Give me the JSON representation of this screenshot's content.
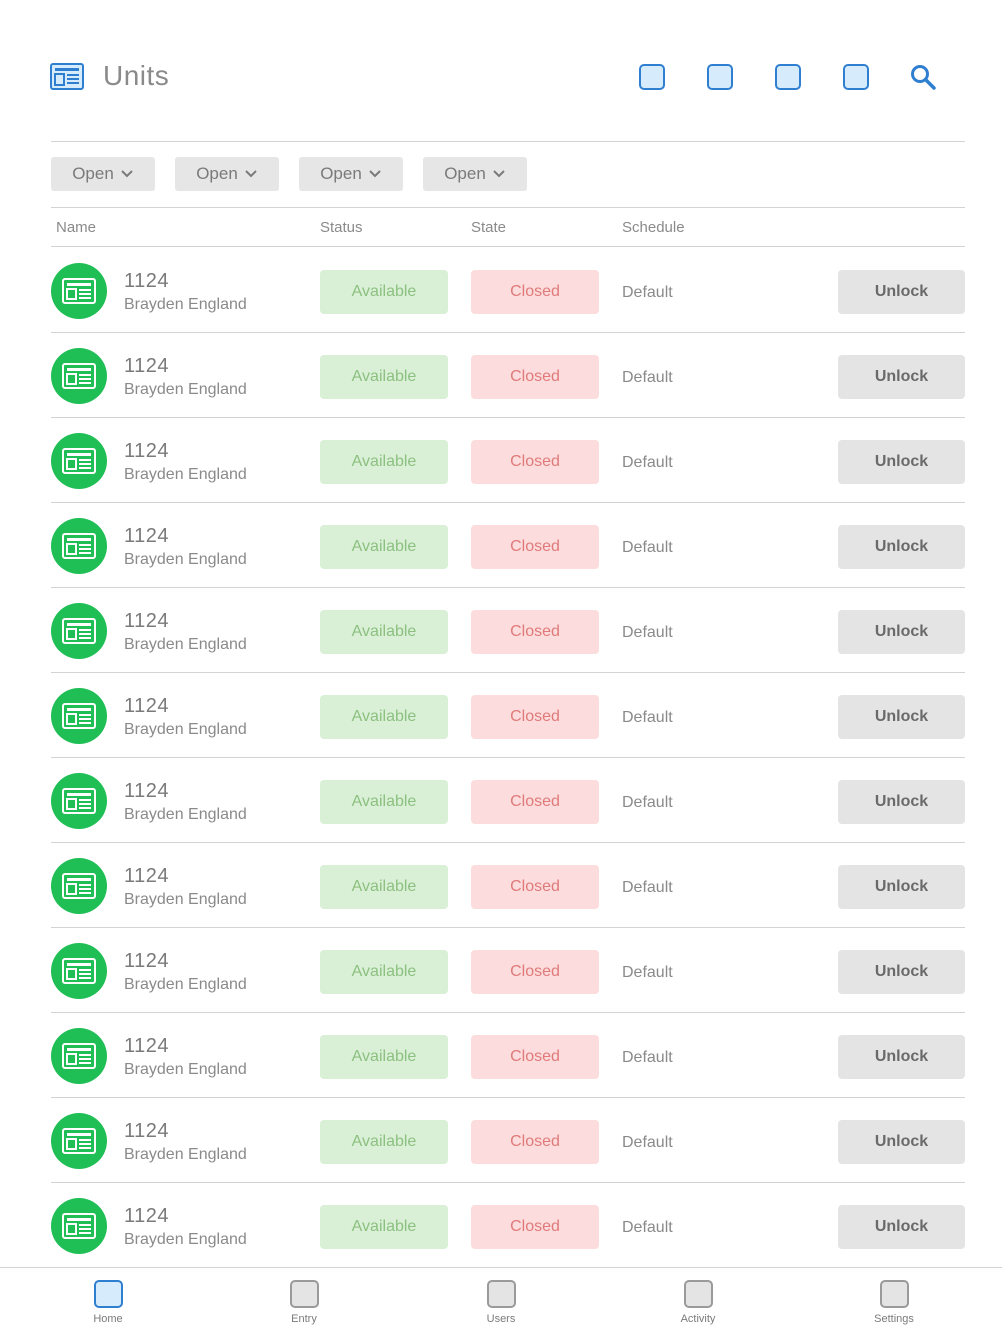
{
  "header": {
    "title": "Units",
    "app_icon": "units-icon",
    "action_icons": [
      "action-icon-1",
      "action-icon-2",
      "action-icon-3",
      "action-icon-4"
    ],
    "search_icon": "search-icon"
  },
  "filters": [
    {
      "label": "Open"
    },
    {
      "label": "Open"
    },
    {
      "label": "Open"
    },
    {
      "label": "Open"
    }
  ],
  "table": {
    "columns": [
      "Name",
      "Status",
      "State",
      "Schedule"
    ],
    "rows": [
      {
        "number": "1124",
        "name": "Brayden England",
        "status": "Available",
        "state": "Closed",
        "schedule": "Default",
        "action": "Unlock"
      },
      {
        "number": "1124",
        "name": "Brayden England",
        "status": "Available",
        "state": "Closed",
        "schedule": "Default",
        "action": "Unlock"
      },
      {
        "number": "1124",
        "name": "Brayden England",
        "status": "Available",
        "state": "Closed",
        "schedule": "Default",
        "action": "Unlock"
      },
      {
        "number": "1124",
        "name": "Brayden England",
        "status": "Available",
        "state": "Closed",
        "schedule": "Default",
        "action": "Unlock"
      },
      {
        "number": "1124",
        "name": "Brayden England",
        "status": "Available",
        "state": "Closed",
        "schedule": "Default",
        "action": "Unlock"
      },
      {
        "number": "1124",
        "name": "Brayden England",
        "status": "Available",
        "state": "Closed",
        "schedule": "Default",
        "action": "Unlock"
      },
      {
        "number": "1124",
        "name": "Brayden England",
        "status": "Available",
        "state": "Closed",
        "schedule": "Default",
        "action": "Unlock"
      },
      {
        "number": "1124",
        "name": "Brayden England",
        "status": "Available",
        "state": "Closed",
        "schedule": "Default",
        "action": "Unlock"
      },
      {
        "number": "1124",
        "name": "Brayden England",
        "status": "Available",
        "state": "Closed",
        "schedule": "Default",
        "action": "Unlock"
      },
      {
        "number": "1124",
        "name": "Brayden England",
        "status": "Available",
        "state": "Closed",
        "schedule": "Default",
        "action": "Unlock"
      },
      {
        "number": "1124",
        "name": "Brayden England",
        "status": "Available",
        "state": "Closed",
        "schedule": "Default",
        "action": "Unlock"
      },
      {
        "number": "1124",
        "name": "Brayden England",
        "status": "Available",
        "state": "Closed",
        "schedule": "Default",
        "action": "Unlock"
      }
    ]
  },
  "bottom_nav": [
    {
      "label": "Home",
      "active": true
    },
    {
      "label": "Entry",
      "active": false
    },
    {
      "label": "Users",
      "active": false
    },
    {
      "label": "Activity",
      "active": false
    },
    {
      "label": "Settings",
      "active": false
    }
  ],
  "colors": {
    "accent": "#2f7fd1",
    "avatar": "#1fbf55",
    "status_bg": "#d9f0d6",
    "status_text": "#8cc080",
    "state_bg": "#fcdcdc",
    "state_text": "#e07a7a"
  }
}
